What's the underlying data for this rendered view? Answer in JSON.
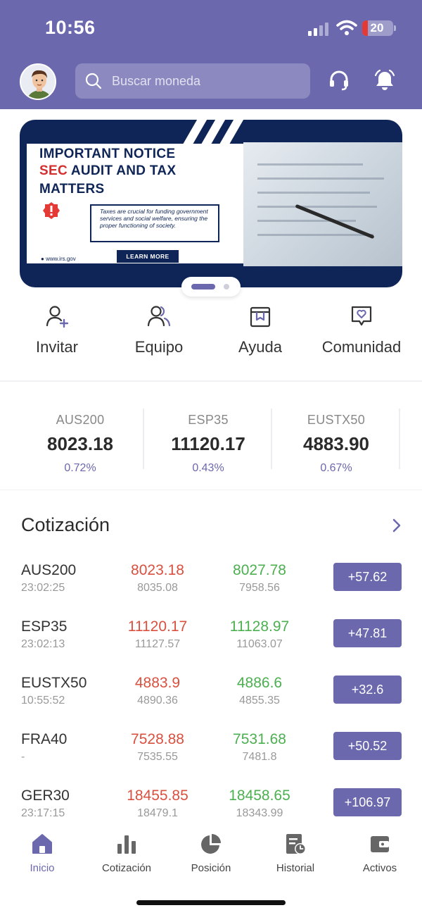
{
  "status_bar": {
    "time": "10:56",
    "battery": "20"
  },
  "header": {
    "search_placeholder": "Buscar moneda",
    "avatar_icon": "avatar-icon",
    "support_icon": "headset-icon",
    "notification_icon": "bell-icon",
    "accent_color": "#6b68ad"
  },
  "banner": {
    "title_line1": "IMPORTANT NOTICE",
    "title_line2_highlight": "SEC",
    "title_line2_rest": " AUDIT AND TAX",
    "title_line3": "MATTERS",
    "body": "Taxes are crucial for funding government services and social welfare, ensuring the proper functioning of society.",
    "button": "LEARN MORE",
    "url": "www.irs.gov",
    "page_count": 2,
    "active_page": 1
  },
  "quick_actions": [
    {
      "label": "Invitar",
      "icon": "invite-user-icon"
    },
    {
      "label": "Equipo",
      "icon": "team-icon"
    },
    {
      "label": "Ayuda",
      "icon": "help-book-icon"
    },
    {
      "label": "Comunidad",
      "icon": "community-chat-icon"
    }
  ],
  "indices": [
    {
      "name": "AUS200",
      "value": "8023.18",
      "change": "0.72%"
    },
    {
      "name": "ESP35",
      "value": "11120.17",
      "change": "0.43%"
    },
    {
      "name": "EUSTX50",
      "value": "4883.90",
      "change": "0.67%"
    }
  ],
  "quotes": {
    "title": "Cotización",
    "rows": [
      {
        "symbol": "AUS200",
        "time": "23:02:25",
        "bid": "8023.18",
        "bid_sub": "8035.08",
        "ask": "8027.78",
        "ask_sub": "7958.56",
        "change": "+57.62"
      },
      {
        "symbol": "ESP35",
        "time": "23:02:13",
        "bid": "11120.17",
        "bid_sub": "11127.57",
        "ask": "11128.97",
        "ask_sub": "11063.07",
        "change": "+47.81"
      },
      {
        "symbol": "EUSTX50",
        "time": "10:55:52",
        "bid": "4883.9",
        "bid_sub": "4890.36",
        "ask": "4886.6",
        "ask_sub": "4855.35",
        "change": "+32.6"
      },
      {
        "symbol": "FRA40",
        "time": "-",
        "bid": "7528.88",
        "bid_sub": "7535.55",
        "ask": "7531.68",
        "ask_sub": "7481.8",
        "change": "+50.52"
      },
      {
        "symbol": "GER30",
        "time": "23:17:15",
        "bid": "18455.85",
        "bid_sub": "18479.1",
        "ask": "18458.65",
        "ask_sub": "18343.99",
        "change": "+106.97"
      }
    ]
  },
  "tabs": [
    {
      "label": "Inicio",
      "icon": "home-icon",
      "active": true
    },
    {
      "label": "Cotización",
      "icon": "bar-chart-icon",
      "active": false
    },
    {
      "label": "Posición",
      "icon": "pie-chart-icon",
      "active": false
    },
    {
      "label": "Historial",
      "icon": "history-icon",
      "active": false
    },
    {
      "label": "Activos",
      "icon": "wallet-icon",
      "active": false
    }
  ]
}
